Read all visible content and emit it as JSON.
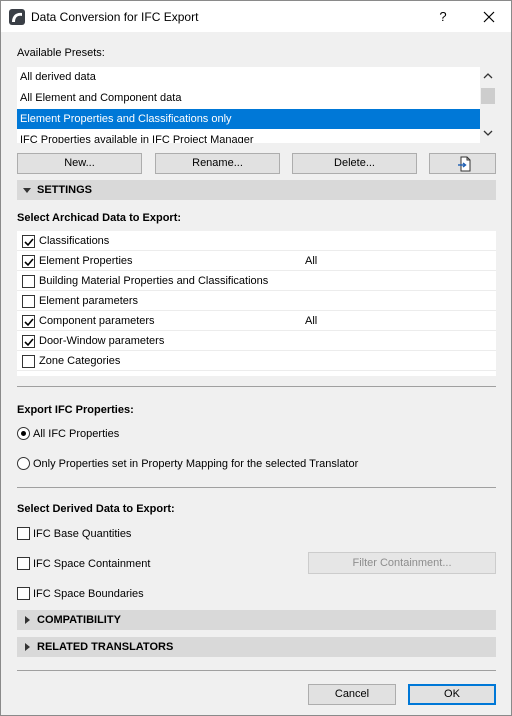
{
  "window": {
    "title": "Data Conversion for IFC Export",
    "help_label": "?"
  },
  "presets": {
    "label": "Available Presets:",
    "items": [
      "All derived data",
      "All Element and Component data",
      "Element Properties and Classifications only",
      "IFC Properties available in IFC Project Manager"
    ],
    "selected_index": 2,
    "buttons": {
      "new": "New...",
      "rename": "Rename...",
      "delete": "Delete..."
    }
  },
  "settings": {
    "header": "SETTINGS",
    "archicad_label": "Select Archicad Data to Export:",
    "archicad_items": [
      {
        "label": "Classifications",
        "checked": true,
        "value": ""
      },
      {
        "label": "Element Properties",
        "checked": true,
        "value": "All"
      },
      {
        "label": "Building Material Properties and Classifications",
        "checked": false,
        "value": ""
      },
      {
        "label": "Element parameters",
        "checked": false,
        "value": ""
      },
      {
        "label": "Component parameters",
        "checked": true,
        "value": "All"
      },
      {
        "label": "Door-Window parameters",
        "checked": true,
        "value": ""
      },
      {
        "label": "Zone Categories",
        "checked": false,
        "value": ""
      }
    ],
    "ifc_props_label": "Export IFC Properties:",
    "ifc_radio_all": "All IFC Properties",
    "ifc_radio_mapping": "Only Properties set in Property Mapping for the selected Translator",
    "ifc_selected": "all",
    "derived_label": "Select Derived Data to Export:",
    "base_quantities": "IFC Base Quantities",
    "space_containment": "IFC Space Containment",
    "filter_containment": "Filter Containment...",
    "space_boundaries": "IFC Space Boundaries"
  },
  "compatibility": {
    "header": "COMPATIBILITY"
  },
  "related": {
    "header": "RELATED TRANSLATORS"
  },
  "footer": {
    "cancel": "Cancel",
    "ok": "OK"
  }
}
